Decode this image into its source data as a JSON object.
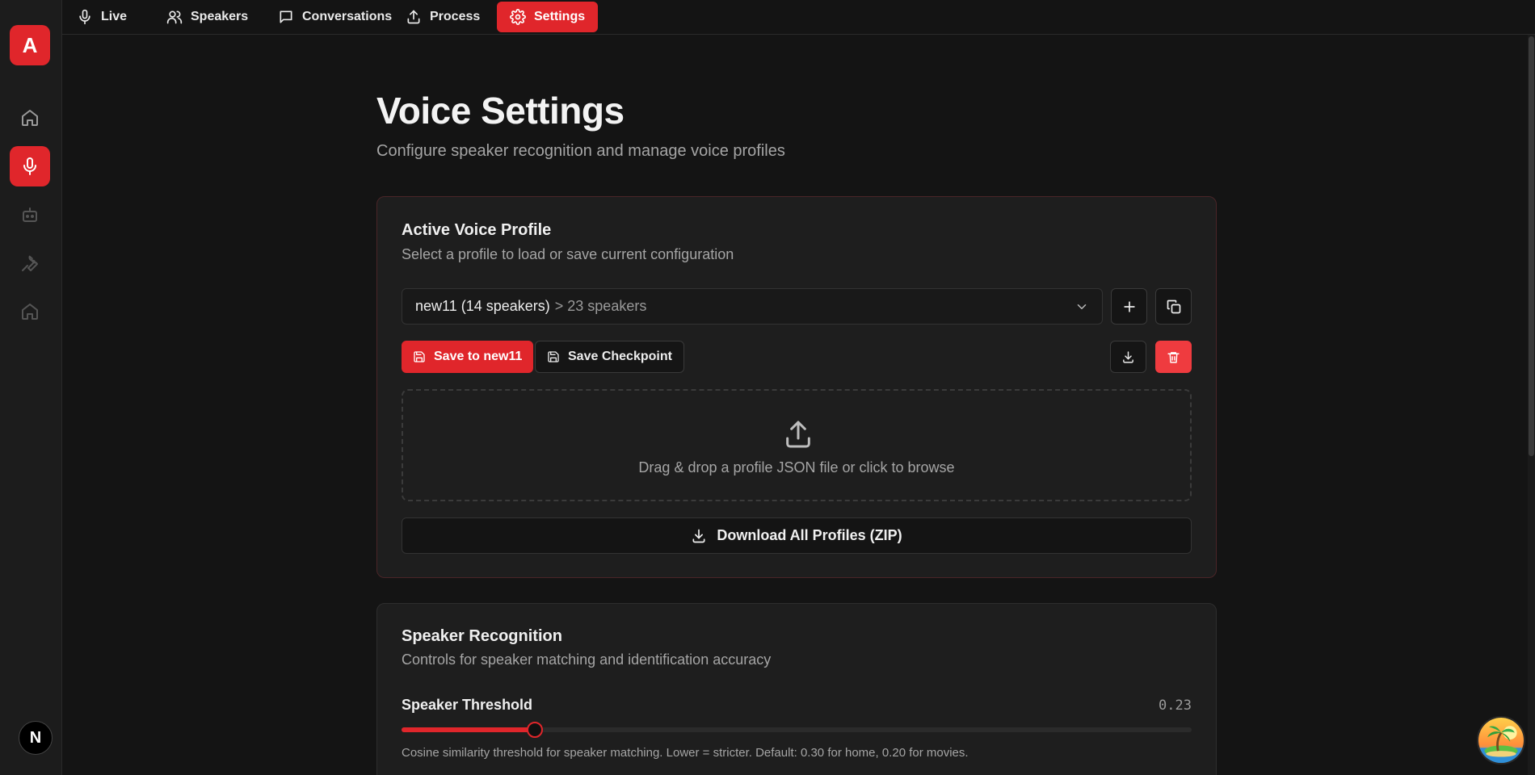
{
  "sidebar": {
    "logo_letter": "A",
    "items": [
      {
        "icon": "home-icon"
      },
      {
        "icon": "mic-icon"
      },
      {
        "icon": "bot-icon"
      },
      {
        "icon": "wrench-icon"
      },
      {
        "icon": "home-alt-icon"
      }
    ],
    "avatar_letter": "N"
  },
  "nav": {
    "tabs": [
      {
        "label": "Live",
        "icon": "mic-icon"
      },
      {
        "label": "Speakers",
        "icon": "users-icon"
      },
      {
        "label": "Conversations",
        "icon": "message-icon"
      },
      {
        "label": "Process",
        "icon": "upload-icon"
      },
      {
        "label": "Settings",
        "icon": "gear-icon"
      }
    ],
    "active_tab": "Settings"
  },
  "header": {
    "title": "Voice Settings",
    "subtitle": "Configure speaker recognition and manage voice profiles"
  },
  "profile_card": {
    "title": "Active Voice Profile",
    "subtitle": "Select a profile to load or save current configuration",
    "selected_profile": "new11 (14 speakers)",
    "selected_extra": "> 23 speakers",
    "save_label": "Save to new11",
    "checkpoint_label": "Save Checkpoint",
    "dropzone_text": "Drag & drop a profile JSON file or click to browse",
    "download_all_label": "Download All Profiles (ZIP)"
  },
  "recognition_card": {
    "title": "Speaker Recognition",
    "subtitle": "Controls for speaker matching and identification accuracy",
    "threshold_label": "Speaker Threshold",
    "threshold_value": "0.23",
    "threshold_fraction": 0.1686,
    "threshold_help": "Cosine similarity threshold for speaker matching. Lower = stricter. Default: 0.30 for home, 0.20 for movies."
  },
  "colors": {
    "accent": "#e0262b",
    "background": "#141414",
    "card": "#1e1e1e"
  }
}
